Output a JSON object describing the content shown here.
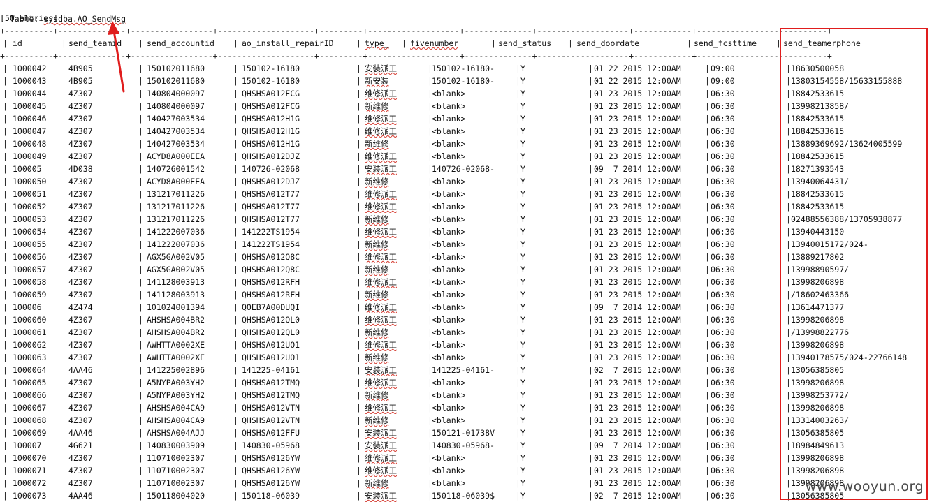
{
  "title": {
    "prefix": "Table: ",
    "name": "sysdba.AO_SendMsg"
  },
  "entries_label": "[50 entries]",
  "columns": [
    "id",
    "send_teamid",
    "send_accountid",
    "ao_install_repairID",
    "type_",
    "fivenumber",
    "send_status",
    "send_doordate",
    "send_fcsttime",
    "send_teamerphone"
  ],
  "rows": [
    [
      "1000042",
      "4B905",
      "150102011680",
      "150102-16180",
      "安装派工",
      "150102-16180-",
      "Y",
      "01 22 2015 12:00AM",
      "09:00",
      "18630500058"
    ],
    [
      "1000043",
      "4B905",
      "150102011680",
      "150102-16180",
      "新安装",
      "150102-16180-",
      "Y",
      "01 22 2015 12:00AM",
      "09:00",
      "13803154558/15633155888"
    ],
    [
      "1000044",
      "4Z307",
      "140804000097",
      "QHSHSA012FCG",
      "维修派工",
      "<blank>",
      "Y",
      "01 23 2015 12:00AM",
      "06:30",
      "18842533615"
    ],
    [
      "1000045",
      "4Z307",
      "140804000097",
      "QHSHSA012FCG",
      "新维修",
      "<blank>",
      "Y",
      "01 23 2015 12:00AM",
      "06:30",
      "13998213858/"
    ],
    [
      "1000046",
      "4Z307",
      "140427003534",
      "QHSHSA012H1G",
      "维修派工",
      "<blank>",
      "Y",
      "01 23 2015 12:00AM",
      "06:30",
      "18842533615"
    ],
    [
      "1000047",
      "4Z307",
      "140427003534",
      "QHSHSA012H1G",
      "维修派工",
      "<blank>",
      "Y",
      "01 23 2015 12:00AM",
      "06:30",
      "18842533615"
    ],
    [
      "1000048",
      "4Z307",
      "140427003534",
      "QHSHSA012H1G",
      "新维修",
      "<blank>",
      "Y",
      "01 23 2015 12:00AM",
      "06:30",
      "13889369692/13624005599"
    ],
    [
      "1000049",
      "4Z307",
      "ACYD8A000EEA",
      "QHSHSA012DJZ",
      "维修派工",
      "<blank>",
      "Y",
      "01 23 2015 12:00AM",
      "06:30",
      "18842533615"
    ],
    [
      "100005",
      "4D038",
      "140726001542",
      "140726-02068",
      "安装派工",
      "140726-02068-",
      "Y",
      "09  7 2014 12:00AM",
      "06:30",
      "18271393543"
    ],
    [
      "1000050",
      "4Z307",
      "ACYD8A000EEA",
      "QHSHSA012DJZ",
      "新维修",
      "<blank>",
      "Y",
      "01 23 2015 12:00AM",
      "06:30",
      "13940064431/"
    ],
    [
      "1000051",
      "4Z307",
      "131217011226",
      "QHSHSA012T77",
      "维修派工",
      "<blank>",
      "Y",
      "01 23 2015 12:00AM",
      "06:30",
      "18842533615"
    ],
    [
      "1000052",
      "4Z307",
      "131217011226",
      "QHSHSA012T77",
      "维修派工",
      "<blank>",
      "Y",
      "01 23 2015 12:00AM",
      "06:30",
      "18842533615"
    ],
    [
      "1000053",
      "4Z307",
      "131217011226",
      "QHSHSA012T77",
      "新维修",
      "<blank>",
      "Y",
      "01 23 2015 12:00AM",
      "06:30",
      "02488556388/13705938877"
    ],
    [
      "1000054",
      "4Z307",
      "141222007036",
      "141222TS1954",
      "维修派工",
      "<blank>",
      "Y",
      "01 23 2015 12:00AM",
      "06:30",
      "13940443150"
    ],
    [
      "1000055",
      "4Z307",
      "141222007036",
      "141222TS1954",
      "新维修",
      "<blank>",
      "Y",
      "01 23 2015 12:00AM",
      "06:30",
      "13940015172/024-"
    ],
    [
      "1000056",
      "4Z307",
      "AGX5GA002V05",
      "QHSHSA012Q8C",
      "维修派工",
      "<blank>",
      "Y",
      "01 23 2015 12:00AM",
      "06:30",
      "13889217802"
    ],
    [
      "1000057",
      "4Z307",
      "AGX5GA002V05",
      "QHSHSA012Q8C",
      "新维修",
      "<blank>",
      "Y",
      "01 23 2015 12:00AM",
      "06:30",
      "13998890597/"
    ],
    [
      "1000058",
      "4Z307",
      "141128003913",
      "QHSHSA012RFH",
      "维修派工",
      "<blank>",
      "Y",
      "01 23 2015 12:00AM",
      "06:30",
      "13998206898"
    ],
    [
      "1000059",
      "4Z307",
      "141128003913",
      "QHSHSA012RFH",
      "新维修",
      "<blank>",
      "Y",
      "01 23 2015 12:00AM",
      "06:30",
      "/18602463366"
    ],
    [
      "100006",
      "4Z474",
      "101024001394",
      "QOEB7A00DUQI",
      "维修派工",
      "<blank>",
      "Y",
      "09  7 2014 12:00AM",
      "06:30",
      "13614471377"
    ],
    [
      "1000060",
      "4Z307",
      "AHSHSA004BR2",
      "QHSHSA012QL0",
      "维修派工",
      "<blank>",
      "Y",
      "01 23 2015 12:00AM",
      "06:30",
      "13998206898"
    ],
    [
      "1000061",
      "4Z307",
      "AHSHSA004BR2",
      "QHSHSA012QL0",
      "新维修",
      "<blank>",
      "Y",
      "01 23 2015 12:00AM",
      "06:30",
      "/13998822776"
    ],
    [
      "1000062",
      "4Z307",
      "AWHTTA0002XE",
      "QHSHSA012UO1",
      "维修派工",
      "<blank>",
      "Y",
      "01 23 2015 12:00AM",
      "06:30",
      "13998206898"
    ],
    [
      "1000063",
      "4Z307",
      "AWHTTA0002XE",
      "QHSHSA012UO1",
      "新维修",
      "<blank>",
      "Y",
      "01 23 2015 12:00AM",
      "06:30",
      "13940178575/024-22766148"
    ],
    [
      "1000064",
      "4AA46",
      "141225002896",
      "141225-04161",
      "安装派工",
      "141225-04161-",
      "Y",
      "02  7 2015 12:00AM",
      "06:30",
      "13056385805"
    ],
    [
      "1000065",
      "4Z307",
      "A5NYPA003YH2",
      "QHSHSA012TMQ",
      "维修派工",
      "<blank>",
      "Y",
      "01 23 2015 12:00AM",
      "06:30",
      "13998206898"
    ],
    [
      "1000066",
      "4Z307",
      "A5NYPA003YH2",
      "QHSHSA012TMQ",
      "新维修",
      "<blank>",
      "Y",
      "01 23 2015 12:00AM",
      "06:30",
      "13998253772/"
    ],
    [
      "1000067",
      "4Z307",
      "AHSHSA004CA9",
      "QHSHSA012VTN",
      "维修派工",
      "<blank>",
      "Y",
      "01 23 2015 12:00AM",
      "06:30",
      "13998206898"
    ],
    [
      "1000068",
      "4Z307",
      "AHSHSA004CA9",
      "QHSHSA012VTN",
      "新维修",
      "<blank>",
      "Y",
      "01 23 2015 12:00AM",
      "06:30",
      "13314003263/"
    ],
    [
      "1000069",
      "4AA46",
      "AHSHSA004AJJ",
      "QHSHSA012FFU",
      "安装派工",
      "150121-01738V",
      "Y",
      "01 23 2015 12:00AM",
      "06:30",
      "13056385805"
    ],
    [
      "100007",
      "4G621",
      "140830003909",
      "140830-05968",
      "安装派工",
      "140830-05968-",
      "Y",
      "09  7 2014 12:00AM",
      "06:30",
      "18984849613"
    ],
    [
      "1000070",
      "4Z307",
      "110710002307",
      "QHSHSA0126YW",
      "维修派工",
      "<blank>",
      "Y",
      "01 23 2015 12:00AM",
      "06:30",
      "13998206898"
    ],
    [
      "1000071",
      "4Z307",
      "110710002307",
      "QHSHSA0126YW",
      "维修派工",
      "<blank>",
      "Y",
      "01 23 2015 12:00AM",
      "06:30",
      "13998206898"
    ],
    [
      "1000072",
      "4Z307",
      "110710002307",
      "QHSHSA0126YW",
      "新维修",
      "<blank>",
      "Y",
      "01 23 2015 12:00AM",
      "06:30",
      "13998206898"
    ],
    [
      "1000073",
      "4AA46",
      "150118004020",
      "150118-06039",
      "安装派工",
      "150118-06039$",
      "Y",
      "02  7 2015 12:00AM",
      "06:30",
      "13056385805"
    ]
  ],
  "watermark": "www.wooyun.org",
  "colors": {
    "highlight_box": "#e01d1d",
    "arrow": "#e01d1d",
    "spellcheck_underline": "#d43a2f"
  }
}
